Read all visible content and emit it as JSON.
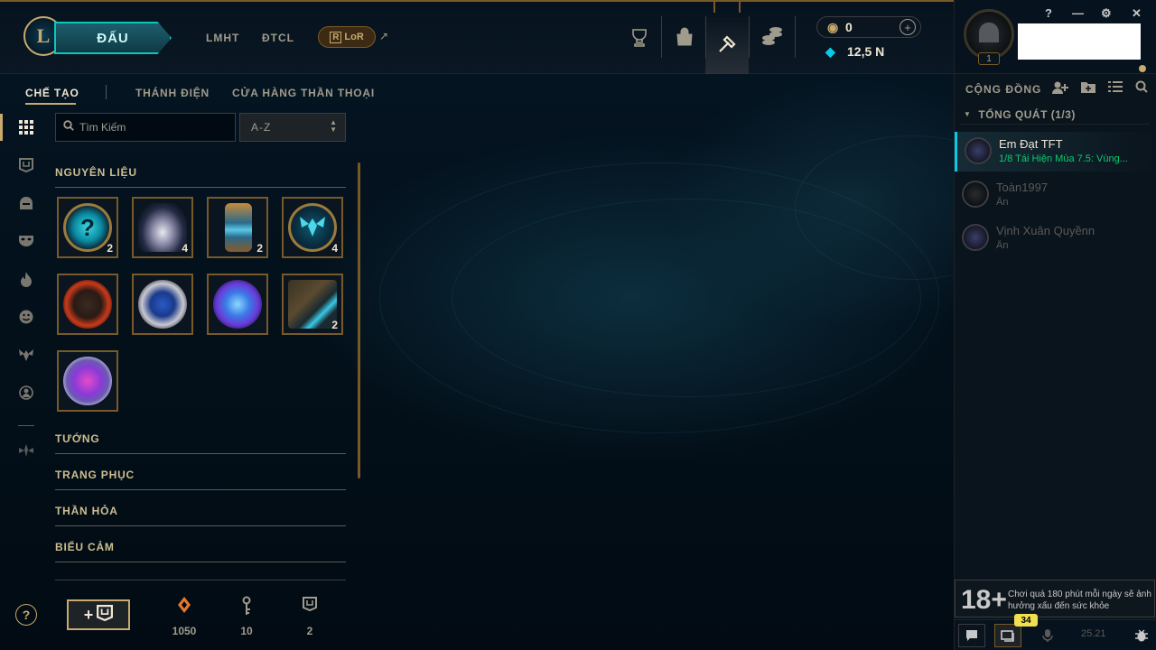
{
  "topnav": {
    "logo_letter": "L",
    "play_label": "ĐẤU",
    "links": [
      "LMHT",
      "ĐTCL"
    ],
    "lor_label": "LoR",
    "external_arrow": "↗",
    "icons": [
      "trophy-icon",
      "store-bag-icon",
      "crafting-hammer-icon",
      "loot-coins-icon"
    ]
  },
  "currency": {
    "rp_value": "0",
    "be_value": "12,5 N",
    "add_label": "+"
  },
  "profile": {
    "level": "1",
    "status_color": "#c8aa6e"
  },
  "window_controls": {
    "help": "?",
    "minimize": "—",
    "settings": "⚙",
    "close": "✕"
  },
  "social": {
    "header": "CỘNG ĐỒNG",
    "group_label": "TỔNG QUÁT (1/3)",
    "friends": [
      {
        "name": "Em Đạt TFT",
        "status": "1/8 Tái Hiện Mùa 7.5: Vùng...",
        "online": true
      },
      {
        "name": "Toàn1997",
        "status": "Ẩn",
        "online": false
      },
      {
        "name": "Vịnh Xuân Quyềnn",
        "status": "Ẩn",
        "online": false
      }
    ],
    "warning_badge": "18+",
    "warning_text": "Chơi quá 180 phút mỗi ngày sẽ ảnh hưởng xấu đến sức khỏe",
    "notification_count": "34",
    "version": "25.21"
  },
  "crafting": {
    "tabs": [
      "CHẾ TẠO",
      "THÁNH ĐIỆN",
      "CỬA HÀNG THẦN THOẠI"
    ],
    "active_tab": "CHẾ TẠO",
    "search_placeholder": "Tìm Kiếm",
    "sort_value": "A-Z",
    "sections": {
      "materials": "NGUYÊN LIỆU",
      "champions": "TƯỚNG",
      "skins": "TRANG PHỤC",
      "wards": "THẦN HỎA",
      "emotes": "BIỂU CẢM"
    },
    "materials": [
      {
        "name": "mystery-orb",
        "count": "2"
      },
      {
        "name": "lantern-capsule",
        "count": "4"
      },
      {
        "name": "hextech-lantern",
        "count": "2"
      },
      {
        "name": "token-orb",
        "count": "4"
      },
      {
        "name": "infernal-orb",
        "count": ""
      },
      {
        "name": "crystal-orb",
        "count": ""
      },
      {
        "name": "blue-essence-orb",
        "count": ""
      },
      {
        "name": "hextech-chest",
        "count": "2"
      },
      {
        "name": "nova-orb",
        "count": ""
      }
    ],
    "footer": {
      "help": "?",
      "add_chest_label": "+",
      "orange_essence": "1050",
      "keys": "10",
      "chests": "2"
    }
  }
}
